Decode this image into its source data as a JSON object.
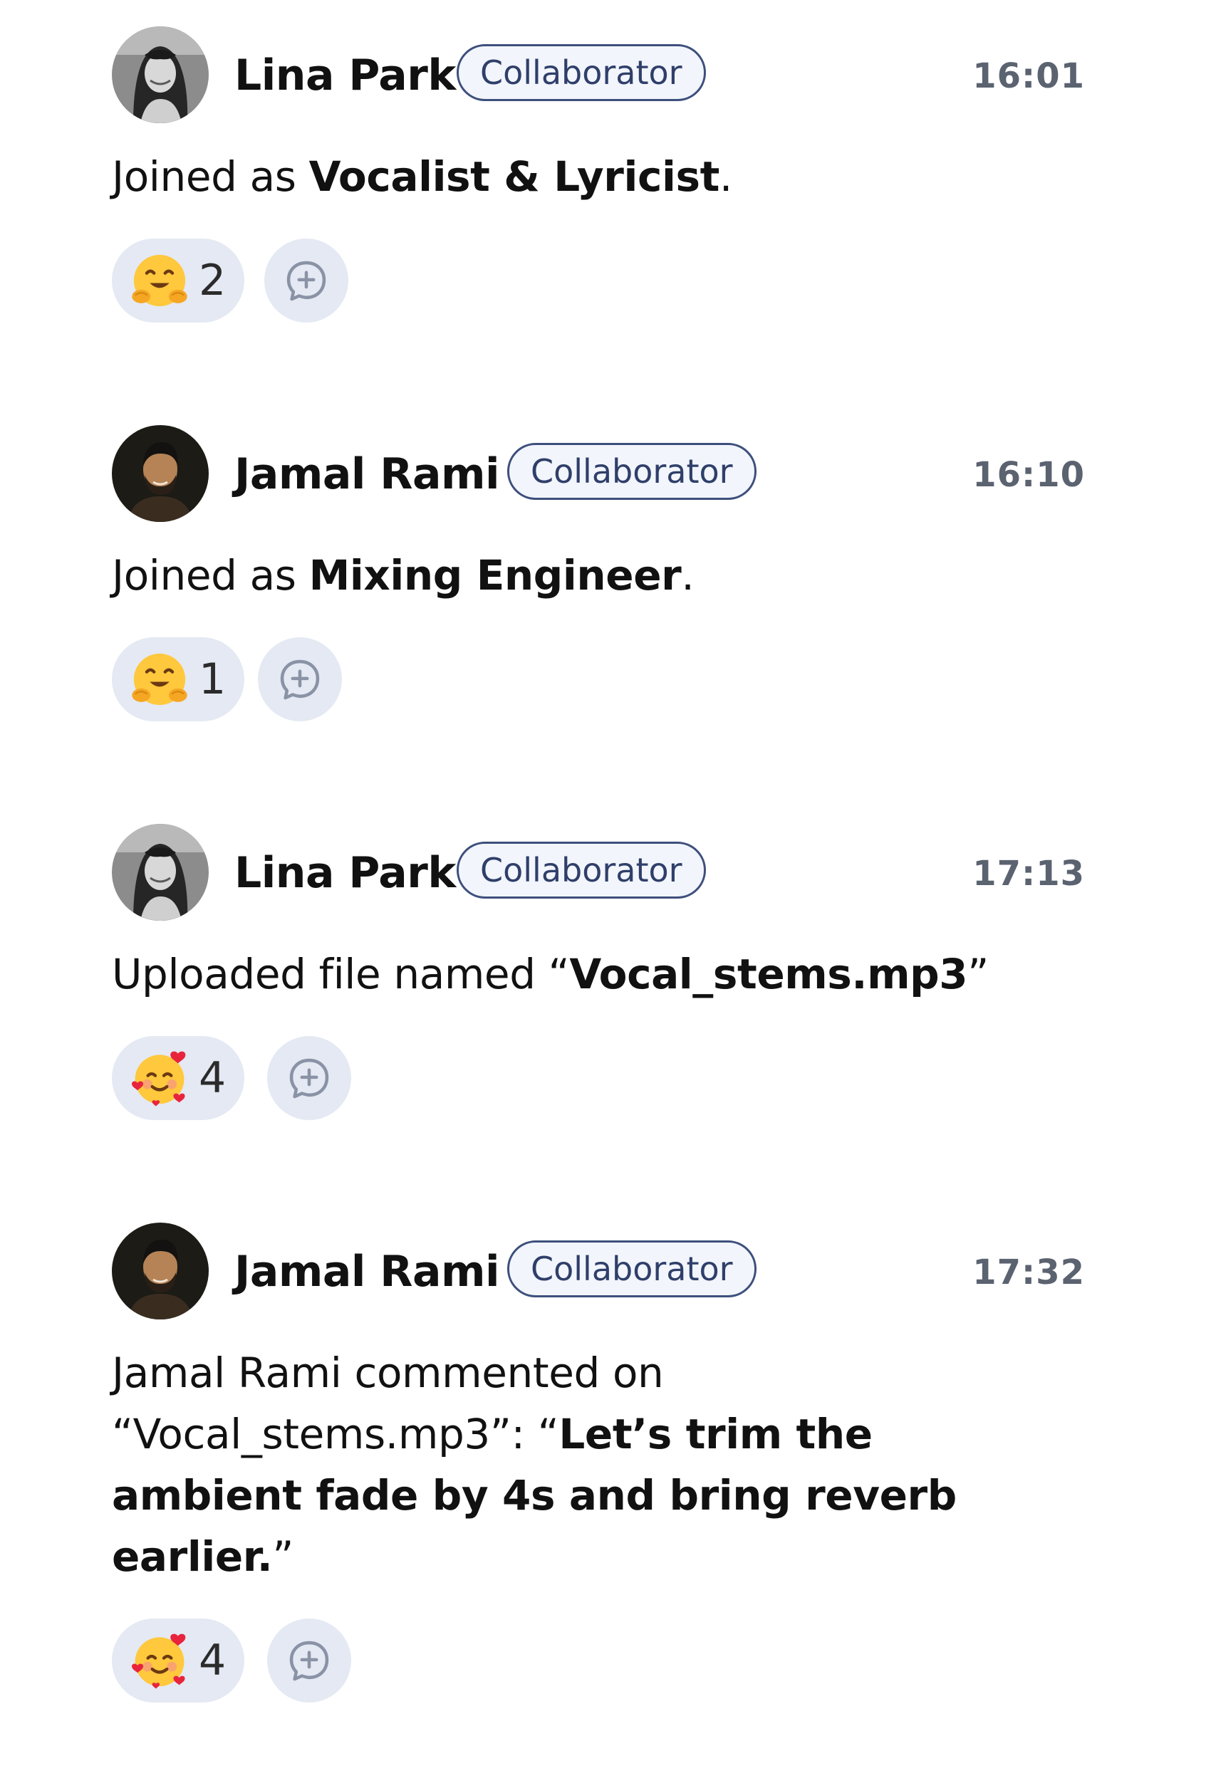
{
  "feed": {
    "entries": [
      {
        "author": "Lina Park",
        "role": "Collaborator",
        "time": "16:01",
        "body_prefix": "Joined as ",
        "body_bold": "Vocalist & Lyricist",
        "body_suffix": ".",
        "reaction_icon": "hugging-face-emoji",
        "reaction_count": "2"
      },
      {
        "author": "Jamal Rami",
        "role": "Collaborator",
        "time": "16:10",
        "body_prefix": "Joined as ",
        "body_bold": "Mixing Engineer",
        "body_suffix": ".",
        "reaction_icon": "hugging-face-emoji",
        "reaction_count": "1"
      },
      {
        "author": "Lina Park",
        "role": "Collaborator",
        "time": "17:13",
        "body_prefix": "Uploaded file named “",
        "body_bold": "Vocal_stems.mp3",
        "body_suffix": "”",
        "reaction_icon": "smiling-face-with-hearts-emoji",
        "reaction_count": "4"
      },
      {
        "author": "Jamal Rami",
        "role": "Collaborator",
        "time": "17:32",
        "body_prefix": "Jamal Rami commented on “Vocal_stems.mp3”: “",
        "body_bold": "Let’s trim the ambient fade by 4s and bring reverb earlier.",
        "body_suffix": "”",
        "reaction_icon": "smiling-face-with-hearts-emoji",
        "reaction_count": "4"
      }
    ],
    "add_reaction_icon": "add-reaction-icon",
    "colors": {
      "badge_border": "#3d4f7c",
      "badge_text": "#2f3f6a",
      "chip_background": "#e4e9f3",
      "timestamp": "#5b6270",
      "text": "#111111"
    }
  }
}
